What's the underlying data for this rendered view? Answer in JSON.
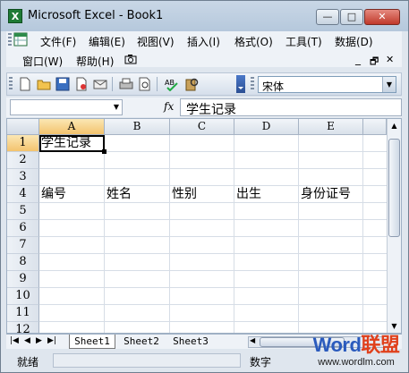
{
  "window": {
    "title": "Microsoft Excel - Book1",
    "app_icon": "excel-icon"
  },
  "window_controls": {
    "minimize": "—",
    "maximize": "□",
    "close": "✕"
  },
  "menubar": {
    "row1": [
      "文件(F)",
      "编辑(E)",
      "视图(V)",
      "插入(I)",
      "格式(O)",
      "工具(T)",
      "数据(D)"
    ],
    "row2": [
      "窗口(W)",
      "帮助(H)"
    ],
    "doc_controls": {
      "minimize": "_",
      "restore": "🗗",
      "close": "✕"
    }
  },
  "toolbar": {
    "icons": [
      "new-icon",
      "open-icon",
      "save-icon",
      "permission-icon",
      "email-icon",
      "print-icon",
      "print-preview-icon",
      "spelling-icon",
      "research-icon"
    ],
    "font_name": "宋体"
  },
  "formula_bar": {
    "name_box": "",
    "fx_label": "fx",
    "content": "学生记录"
  },
  "sheet": {
    "columns": [
      "A",
      "B",
      "C",
      "D",
      "E"
    ],
    "rows": [
      "1",
      "2",
      "3",
      "4",
      "5",
      "6",
      "7",
      "8",
      "9",
      "10",
      "11",
      "12"
    ],
    "selected_cell": "A1",
    "cells": {
      "a1": "学生记录",
      "a4": "编号",
      "b4": "姓名",
      "c4": "性别",
      "d4": "出生",
      "e4": "身份证号"
    }
  },
  "sheet_tabs": [
    "Sheet1",
    "Sheet2",
    "Sheet3"
  ],
  "active_tab": "Sheet1",
  "status": {
    "ready": "就绪",
    "num": "数字"
  },
  "watermark": {
    "word": "Word",
    "cn": "联盟",
    "url": "www.wordlm.com"
  },
  "colors": {
    "accent": "#f3c36e",
    "grid": "#d6dde6",
    "watermark_word": "#2b5bbd",
    "watermark_cn": "#e0401b"
  }
}
